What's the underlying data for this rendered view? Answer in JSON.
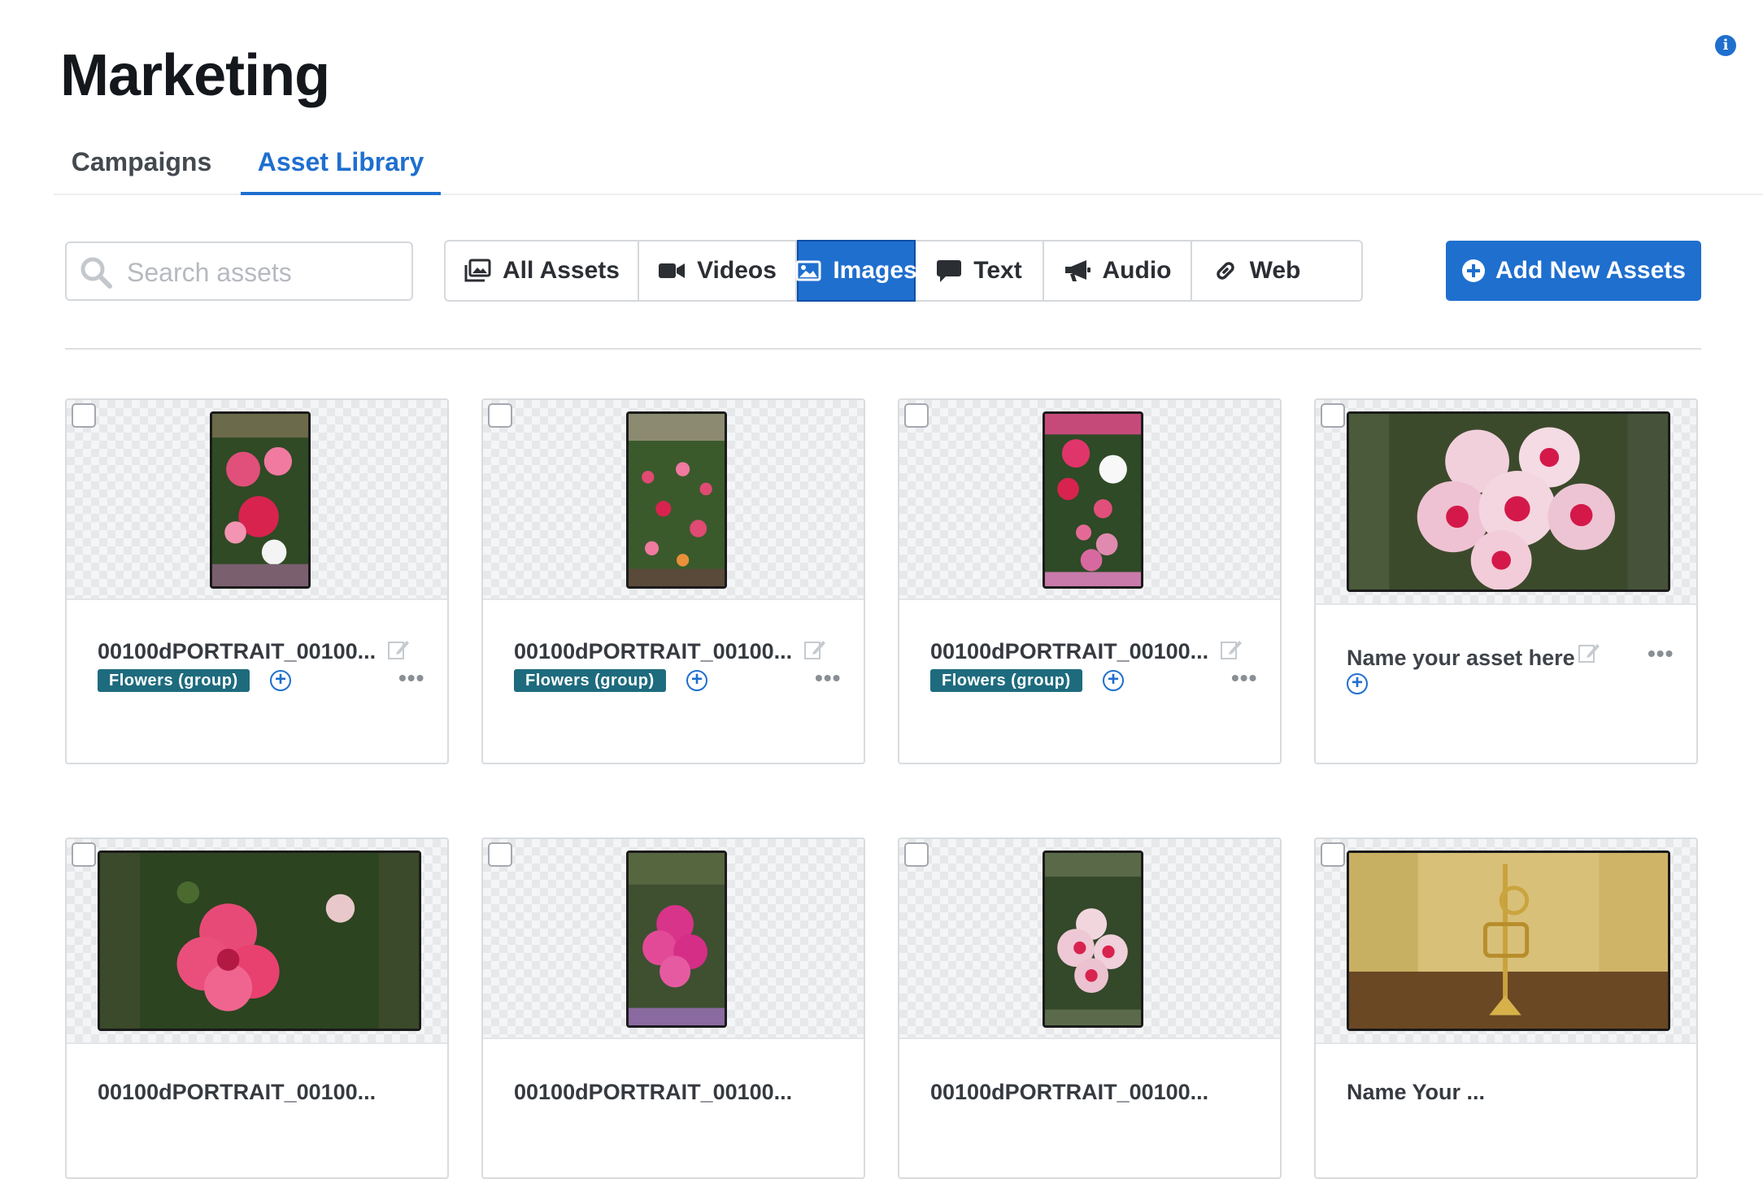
{
  "header": {
    "title": "Marketing"
  },
  "tabs": [
    {
      "label": "Campaigns",
      "active": false
    },
    {
      "label": "Asset Library",
      "active": true
    }
  ],
  "search": {
    "placeholder": "Search assets",
    "value": ""
  },
  "filters": [
    {
      "label": "All Assets",
      "icon": "images-icon",
      "active": false
    },
    {
      "label": "Videos",
      "icon": "video-camera-icon",
      "active": false
    },
    {
      "label": "Images",
      "icon": "image-icon",
      "active": true
    },
    {
      "label": "Text",
      "icon": "speech-bubble-icon",
      "active": false
    },
    {
      "label": "Audio",
      "icon": "megaphone-icon",
      "active": false
    },
    {
      "label": "Web",
      "icon": "link-icon",
      "active": false
    }
  ],
  "add_button": {
    "label": "Add New Assets"
  },
  "colors": {
    "accent": "#1f6fcf",
    "tag": "#1e6b7e"
  },
  "assets": [
    {
      "name": "00100dPORTRAIT_00100...",
      "tag": "Flowers (group)",
      "orientation": "portrait"
    },
    {
      "name": "00100dPORTRAIT_00100...",
      "tag": "Flowers (group)",
      "orientation": "portrait"
    },
    {
      "name": "00100dPORTRAIT_00100...",
      "tag": "Flowers (group)",
      "orientation": "portrait"
    },
    {
      "name": "Name your asset here",
      "tag": "",
      "orientation": "landscape"
    },
    {
      "name": "00100dPORTRAIT_00100...",
      "orientation": "landscape"
    },
    {
      "name": "00100dPORTRAIT_00100...",
      "orientation": "portrait"
    },
    {
      "name": "00100dPORTRAIT_00100...",
      "orientation": "portrait"
    },
    {
      "name": "Name Your ...",
      "orientation": "landscape"
    }
  ],
  "more_label": "•••",
  "plus_label": "+"
}
